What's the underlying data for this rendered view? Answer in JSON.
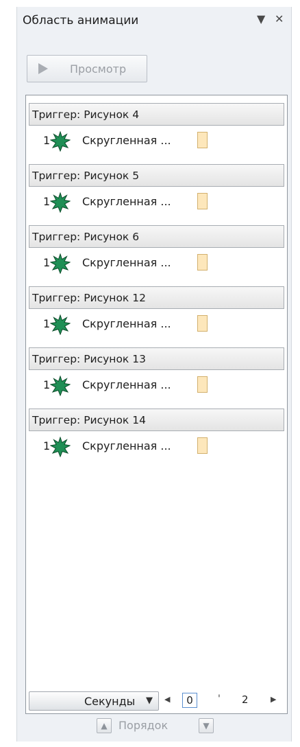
{
  "pane": {
    "title": "Область анимации",
    "menu_glyph": "▼",
    "close_glyph": "✕",
    "preview_label": "Просмотр"
  },
  "groups": [
    {
      "trigger": "Триггер: Рисунок 4",
      "num": "1",
      "effect": "Скругленная ..."
    },
    {
      "trigger": "Триггер: Рисунок 5",
      "num": "1",
      "effect": "Скругленная ..."
    },
    {
      "trigger": "Триггер: Рисунок 6",
      "num": "1",
      "effect": "Скругленная ..."
    },
    {
      "trigger": "Триггер: Рисунок 12",
      "num": "1",
      "effect": "Скругленная ..."
    },
    {
      "trigger": "Триггер: Рисунок 13",
      "num": "1",
      "effect": "Скругленная ..."
    },
    {
      "trigger": "Триггер: Рисунок 14",
      "num": "1",
      "effect": "Скругленная ..."
    }
  ],
  "timeline": {
    "seconds_label": "Секунды",
    "dropdown_glyph": "▼",
    "left_glyph": "◀",
    "right_glyph": "▶",
    "start_value": "0",
    "tick_glyph": "'",
    "end_value": "2"
  },
  "order": {
    "label": "Порядок",
    "up_glyph": "▲",
    "down_glyph": "▼"
  },
  "colors": {
    "effect_star": "#1f8f55",
    "timing_bar": "#fde7bb"
  }
}
